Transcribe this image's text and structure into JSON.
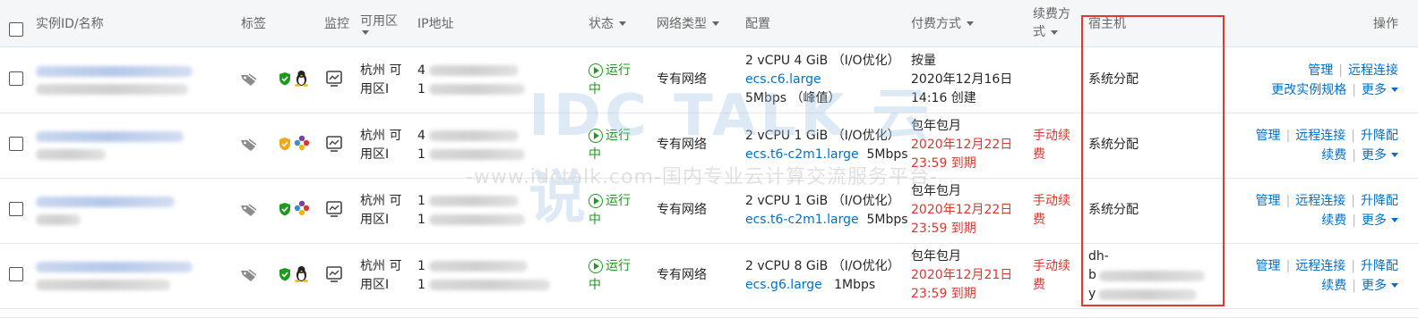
{
  "header": {
    "instance": "实例ID/名称",
    "tags": "标签",
    "monitor": "监控",
    "zone": "可用区",
    "ip": "IP地址",
    "status": "状态",
    "network": "网络类型",
    "config": "配置",
    "billing": "付费方式",
    "renew_line1": "续费方",
    "renew_line2": "式",
    "host": "宿主机",
    "ops": "操作"
  },
  "watermark": {
    "logo": "IDC TALK 云说",
    "slogan": "-www.idctalk.com-国内专业云计算交流服务平台-"
  },
  "rows": [
    {
      "zone1": "杭州 可",
      "zone2": "用区I",
      "ip1": "4",
      "ip2": "1",
      "status1": "运行",
      "status2": "中",
      "network": "专有网络",
      "cfg1": "2 vCPU 4 GiB （I/O优化）",
      "cfg_type": "ecs.c6.large",
      "cfg_bw": "5Mbps （峰值）",
      "bill1": "按量",
      "bill2": "2020年12月16日",
      "bill3": "14:16 创建",
      "renew1": "",
      "renew2": "",
      "host1": "系统分配",
      "host2": "",
      "host3": "",
      "op_a": "管理",
      "op_b": "远程连接",
      "op_c": "更改实例规格",
      "op_more": "更多"
    },
    {
      "zone1": "杭州 可",
      "zone2": "用区I",
      "ip1": "4",
      "ip2": "1",
      "status1": "运行",
      "status2": "中",
      "network": "专有网络",
      "cfg1": "2 vCPU 1 GiB （I/O优化）",
      "cfg_type": "ecs.t6-c2m1.large",
      "cfg_bw": "5Mbps",
      "bill1": "包年包月",
      "bill2": "2020年12月22日",
      "bill3": "23:59 到期",
      "renew1": "手动续",
      "renew2": "费",
      "host1": "系统分配",
      "host2": "",
      "host3": "",
      "op_a": "管理",
      "op_b": "远程连接",
      "op_c": "升降配",
      "op_d": "续费",
      "op_more": "更多"
    },
    {
      "zone1": "杭州 可",
      "zone2": "用区I",
      "ip1": "1",
      "ip2": "1",
      "status1": "运行",
      "status2": "中",
      "network": "专有网络",
      "cfg1": "2 vCPU 1 GiB （I/O优化）",
      "cfg_type": "ecs.t6-c2m1.large",
      "cfg_bw": "5Mbps",
      "bill1": "包年包月",
      "bill2": "2020年12月22日",
      "bill3": "23:59 到期",
      "renew1": "手动续",
      "renew2": "费",
      "host1": "系统分配",
      "host2": "",
      "host3": "",
      "op_a": "管理",
      "op_b": "远程连接",
      "op_c": "升降配",
      "op_d": "续费",
      "op_more": "更多"
    },
    {
      "zone1": "杭州 可",
      "zone2": "用区I",
      "ip1": "1",
      "ip2": "1",
      "status1": "运行",
      "status2": "中",
      "network": "专有网络",
      "cfg1": "2 vCPU 8 GiB （I/O优化）",
      "cfg_type": "ecs.g6.large",
      "cfg_bw": "1Mbps",
      "bill1": "包年包月",
      "bill2": "2020年12月21日",
      "bill3": "23:59 到期",
      "renew1": "手动续",
      "renew2": "费",
      "host1": "dh-",
      "host2": "b",
      "host3": "y",
      "op_a": "管理",
      "op_b": "远程连接",
      "op_c": "升降配",
      "op_d": "续费",
      "op_more": "更多"
    }
  ],
  "colors": {
    "link": "#0070cc",
    "expire": "#e0352b",
    "running": "#1e9a1e",
    "highlight_box": "#e5382c"
  },
  "icons": [
    "select-all-checkbox",
    "row-checkbox",
    "tag-icon",
    "security-shield-icon",
    "linux-penguin-icon",
    "os-flower-icon",
    "monitor-chart-icon",
    "running-status-icon"
  ]
}
